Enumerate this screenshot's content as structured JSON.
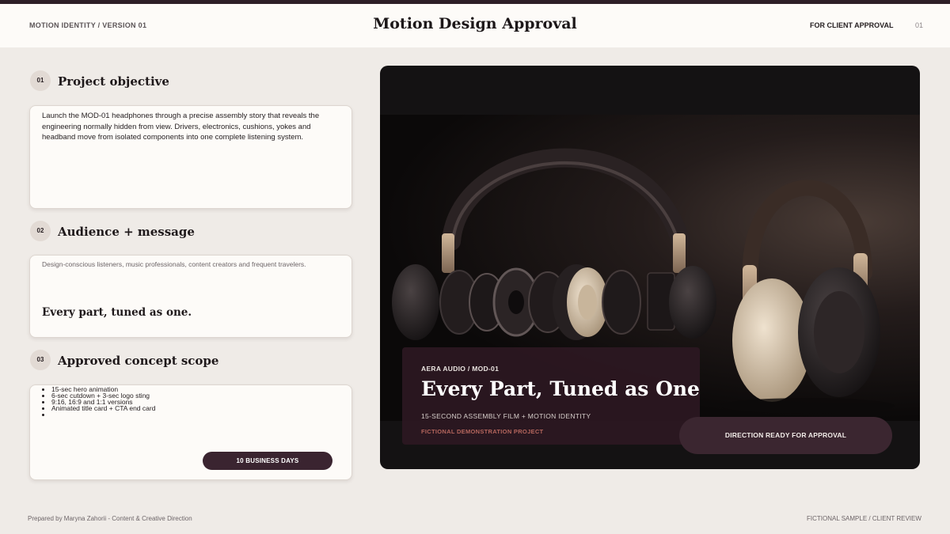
{
  "header": {
    "left_label": "MOTION IDENTITY / VERSION 01",
    "title": "Motion Design Approval",
    "right_label": "FOR CLIENT APPROVAL",
    "page_number": "01"
  },
  "sections": {
    "objective": {
      "number": "01",
      "title": "Project objective",
      "body": "Launch the MOD-01 headphones through a precise assembly story that reveals the engineering normally hidden from view. Drivers, electronics, cushions, yokes and headband move from isolated components into one complete listening system."
    },
    "audience": {
      "number": "02",
      "title": "Audience + message",
      "body": "Design-conscious listeners, music professionals, content creators and frequent travelers.",
      "quote": "Every part, tuned as one."
    },
    "scope": {
      "number": "03",
      "title": "Approved concept scope",
      "items": [
        "15-sec hero animation",
        "6-sec cutdown + 3-sec logo sting",
        "9:16, 16:9 and 1:1 versions",
        "Animated title card + CTA end card",
        ""
      ],
      "timeline_label": "10 BUSINESS DAYS"
    }
  },
  "hero": {
    "brand": "AERA AUDIO / MOD-01",
    "title": "Every Part, Tuned as One",
    "subtitle": "15-SECOND ASSEMBLY FILM + MOTION IDENTITY",
    "note": "FICTIONAL DEMONSTRATION PROJECT",
    "cta_label": "DIRECTION READY FOR APPROVAL"
  },
  "footer": {
    "left": "Prepared by Maryna Zahorii - Content & Creative Direction",
    "right": "FICTIONAL SAMPLE / CLIENT REVIEW"
  },
  "colors": {
    "accent_plum": "#3a2430",
    "page_background": "#efebe7",
    "card_background": "#fdfbf8",
    "note_rust": "#b5665d"
  }
}
